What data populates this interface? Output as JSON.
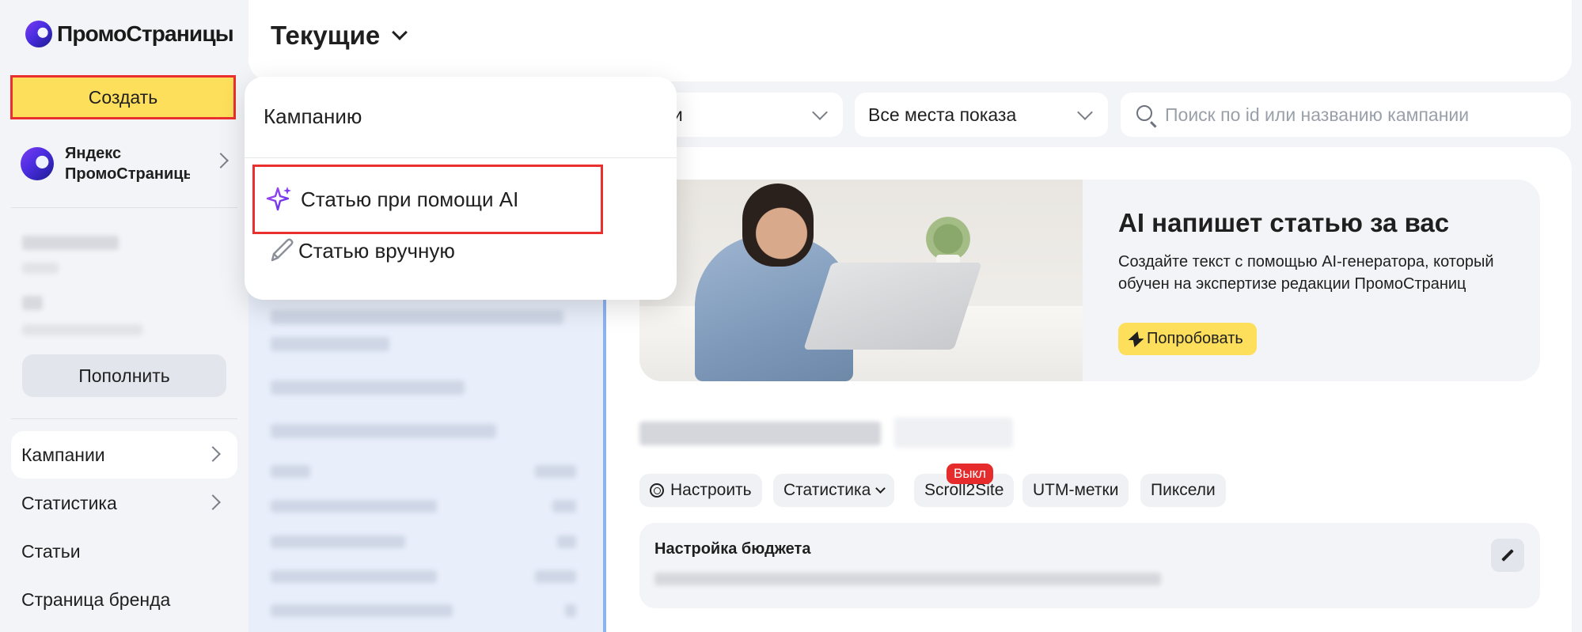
{
  "sidebar": {
    "logo_text": "ПромоСтраницы",
    "create_label": "Создать",
    "account_name_line1": "Яндекс",
    "account_name_line2": "ПромоСтраницы",
    "topup_label": "Пополнить",
    "nav": [
      {
        "label": "Кампании"
      },
      {
        "label": "Статистика"
      },
      {
        "label": "Статьи"
      },
      {
        "label": "Страница бренда"
      }
    ]
  },
  "header": {
    "title": "Текущие"
  },
  "filters": {
    "first_value": "ии",
    "placements_value": "Все места показа",
    "search_placeholder": "Поиск по id или названию кампании"
  },
  "dropdown": {
    "header": "Кампанию",
    "items": [
      {
        "label": "Статью при помощи AI",
        "icon": "sparkle-icon"
      },
      {
        "label": "Статью вручную",
        "icon": "pencil-icon"
      }
    ]
  },
  "banner": {
    "title": "AI напишет статью за вас",
    "text": "Создайте текст с помощью AI-генератора, который обучен на экспертизе редакции ПромоСтраниц",
    "button_label": "Попробовать"
  },
  "campaign": {
    "chips": [
      {
        "label": "Настроить"
      },
      {
        "label": "Статистика"
      },
      {
        "label": "Scroll2Site"
      },
      {
        "label": "UTM-метки"
      },
      {
        "label": "Пиксели"
      }
    ],
    "scroll_badge": "Выкл"
  },
  "budget": {
    "title": "Настройка бюджета"
  },
  "colors": {
    "accent_yellow": "#fddf5b",
    "highlight_red": "#ea2f2f",
    "badge_red": "#e52b2b",
    "panel_blue": "#8db2f0"
  }
}
